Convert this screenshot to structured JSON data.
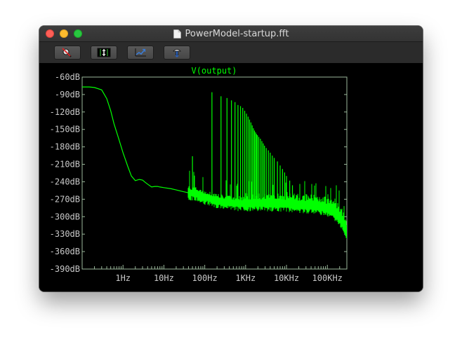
{
  "window": {
    "title": "PowerModel-startup.fft"
  },
  "toolbar": {
    "buttons": [
      {
        "name": "zoom-cancel-button",
        "icon": "magnifier-cancel-icon"
      },
      {
        "name": "autorange-y-button",
        "icon": "vertical-autorange-icon"
      },
      {
        "name": "autorange-xy-button",
        "icon": "xy-autorange-icon"
      },
      {
        "name": "probe-button",
        "icon": "probe-icon"
      }
    ]
  },
  "colors": {
    "trace": "#00ff00",
    "axes": "#9bb89b",
    "label": "#c8c8c8",
    "background": "#000000"
  },
  "chart_data": {
    "type": "line",
    "title": "V(output)",
    "xscale": "log",
    "xlim": [
      0.1,
      300000
    ],
    "ylim": [
      -390,
      -60
    ],
    "x_tick_labels": [
      "1Hz",
      "10Hz",
      "100Hz",
      "1KHz",
      "10KHz",
      "100KHz"
    ],
    "x_tick_values": [
      1,
      10,
      100,
      1000,
      10000,
      100000
    ],
    "y_tick_labels": [
      "-60dB",
      "-90dB",
      "-120dB",
      "-150dB",
      "-180dB",
      "-210dB",
      "-240dB",
      "-270dB",
      "-300dB",
      "-330dB",
      "-360dB",
      "-390dB"
    ],
    "y_tick_values": [
      -60,
      -90,
      -120,
      -150,
      -180,
      -210,
      -240,
      -270,
      -300,
      -330,
      -360,
      -390
    ],
    "series": [
      {
        "name": "V(output)",
        "x": [
          0.1,
          0.15,
          0.2,
          0.3,
          0.4,
          0.5,
          0.6,
          0.8,
          1.0,
          1.3,
          1.6,
          2.0,
          2.5,
          3.0,
          3.5,
          4.0,
          5.0,
          6.0,
          7.0,
          8.0,
          10,
          15,
          20,
          30,
          40,
          60,
          80,
          100,
          150,
          200,
          300,
          500,
          1000,
          2000,
          5000,
          10000,
          20000,
          50000,
          100000,
          150000,
          200000,
          300000
        ],
        "y": [
          -77,
          -77,
          -78,
          -82,
          -97,
          -118,
          -140,
          -168,
          -190,
          -213,
          -230,
          -238,
          -236,
          -237,
          -241,
          -244,
          -249,
          -248,
          -248,
          -249,
          -250,
          -252,
          -254,
          -257,
          -259,
          -262,
          -265,
          -268,
          -271,
          -274,
          -276,
          -278,
          -279,
          -279,
          -279,
          -280,
          -282,
          -284,
          -288,
          -295,
          -305,
          -330
        ]
      }
    ],
    "spikes": {
      "x": [
        50,
        150,
        250,
        350,
        450,
        550,
        650,
        750,
        850,
        950,
        1050,
        1150,
        1250,
        1350,
        1450,
        1550,
        1650,
        1750,
        1850,
        1950,
        2100,
        2300,
        2500,
        2700,
        2900,
        3200,
        3600,
        4000,
        4500,
        5000,
        6000,
        7000,
        8000,
        9000,
        10000,
        12000,
        14000
      ],
      "peak_db": [
        -196,
        -86,
        -93,
        -96,
        -100,
        -103,
        -108,
        -110,
        -113,
        -118,
        -123,
        -128,
        -133,
        -138,
        -143,
        -148,
        -152,
        -155,
        -158,
        -160,
        -163,
        -166,
        -170,
        -174,
        -178,
        -182,
        -186,
        -190,
        -195,
        -199,
        -205,
        -212,
        -218,
        -224,
        -230,
        -238,
        -246
      ]
    }
  }
}
